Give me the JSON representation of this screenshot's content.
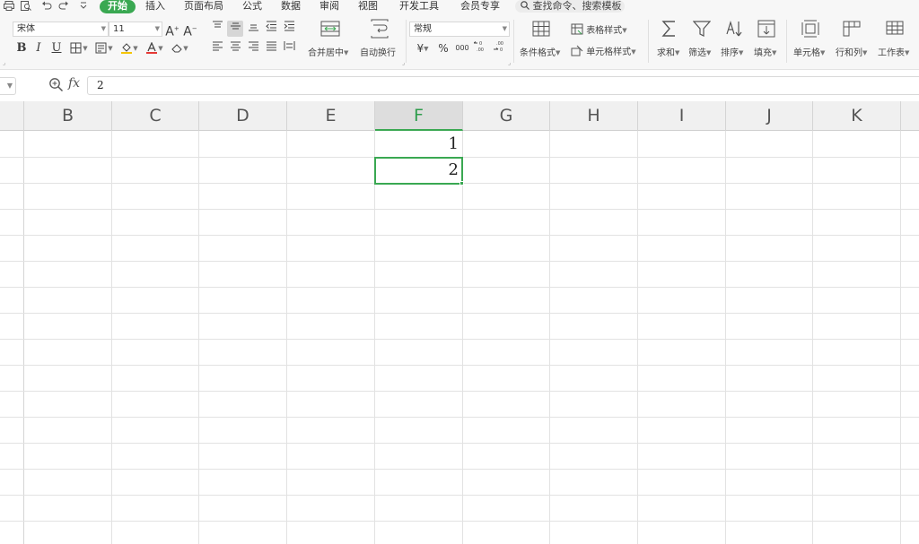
{
  "menubar": {
    "tabs": [
      "开始",
      "插入",
      "页面布局",
      "公式",
      "数据",
      "审阅",
      "视图",
      "开发工具",
      "会员专享"
    ],
    "active_tab": "开始",
    "search_label": "查找命令、搜索模板"
  },
  "ribbon": {
    "font_name": "宋体",
    "font_size": "11",
    "merge_center_label": "合并居中",
    "wrap_text_label": "自动换行",
    "number_format": "常规",
    "currency_symbol": "¥",
    "percent_symbol": "%",
    "thousands_symbol": "000",
    "conditional_format_label": "条件格式",
    "table_style_label": "表格样式",
    "cell_style_label": "单元格样式",
    "sum_label": "求和",
    "filter_label": "筛选",
    "sort_label": "排序",
    "fill_label": "填充",
    "cells_label": "单元格",
    "rows_cols_label": "行和列",
    "worksheet_label": "工作表",
    "bold_label": "B",
    "italic_label": "I",
    "underline_label": "U"
  },
  "formula_bar": {
    "fx_label": "fx",
    "value": "2"
  },
  "sheet": {
    "columns": [
      "B",
      "C",
      "D",
      "E",
      "F",
      "G",
      "H",
      "I",
      "J",
      "K"
    ],
    "active_column": "F",
    "cells": [
      {
        "column": "F",
        "row_index": 0,
        "value": "1"
      },
      {
        "column": "F",
        "row_index": 1,
        "value": "2"
      }
    ]
  },
  "colors": {
    "accent": "#3aa852",
    "grid_line": "#e2e2e2",
    "header_bg": "#f0f0f0"
  }
}
